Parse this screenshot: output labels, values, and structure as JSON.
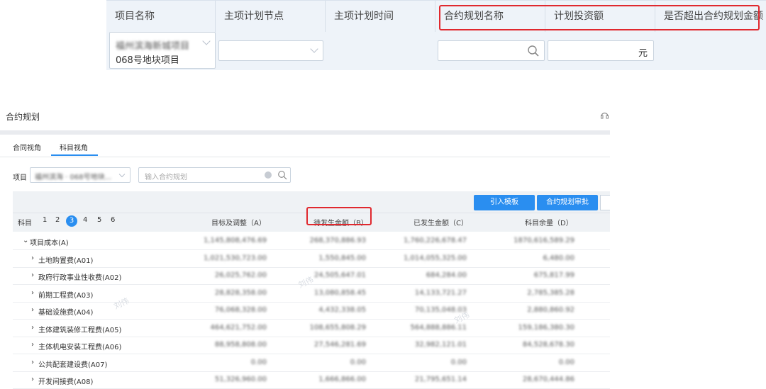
{
  "top_form": {
    "headers": [
      "项目名称",
      "主项计划节点",
      "主项计划时间",
      "合约规划名称",
      "计划投资额",
      "是否超出合约规划金额"
    ],
    "project_value_blurred": "福州滨海新城项目",
    "project_value": "068号地块项目",
    "amount_unit": "元"
  },
  "module": {
    "title": "合约规划",
    "tabs": [
      "合同视角",
      "科目视角"
    ],
    "active_tab": "科目视角",
    "project_label": "项目",
    "project_value": "福州滨海 · 068号地块...",
    "search_placeholder": "输入合约规划",
    "buttons": [
      "引入模板",
      "合约规划审批"
    ],
    "subject_label": "科目",
    "levels": [
      "1",
      "2",
      "3",
      "4",
      "5",
      "6"
    ],
    "current_level": "3",
    "columns": [
      "目标及调整（A）",
      "待发生金额（B）",
      "已发生金额（C）",
      "科目余量（D）"
    ],
    "rows": [
      {
        "name": "项目成本(A)",
        "a": "1,145,808,476.69",
        "b": "268,370,886.93",
        "c": "1,760,226,678.47",
        "d": "1870,616,589.29",
        "group": true
      },
      {
        "name": "土地购置费(A01)",
        "a": "1,021,530,723.00",
        "b": "1,550,845.00",
        "c": "1,014,055,325.00",
        "d": "6,480.00"
      },
      {
        "name": "政府行政事业性收费(A02)",
        "a": "26,025,762.00",
        "b": "24,505,647.01",
        "c": "684,284.00",
        "d": "675,817.99"
      },
      {
        "name": "前期工程费(A03)",
        "a": "28,828,358.00",
        "b": "13,080,858.45",
        "c": "14,133,721.27",
        "d": "2,785,385.28"
      },
      {
        "name": "基础设施费(A04)",
        "a": "76,068,328.00",
        "b": "4,432,338.05",
        "c": "70,135,048.03",
        "d": "2,880,860.92"
      },
      {
        "name": "主体建筑装修工程费(A05)",
        "a": "464,621,752.00",
        "b": "108,655,808.29",
        "c": "564,888,886.11",
        "d": "159,186,380.30"
      },
      {
        "name": "主体机电安装工程费(A06)",
        "a": "88,958,808.00",
        "b": "27,546,281.69",
        "c": "32,982,121.01",
        "d": "84,528,678.30"
      },
      {
        "name": "公共配套建设费(A07)",
        "a": "0.00",
        "b": "0.00",
        "c": "0.00",
        "d": "0.00"
      },
      {
        "name": "开发间接费(A08)",
        "a": "51,326,960.00",
        "b": "1,666,866.00",
        "c": "21,795,651.14",
        "d": "28,670,444.86"
      }
    ]
  },
  "colors": {
    "accent": "#2a8ef0",
    "highlight_box": "#e0282e"
  }
}
